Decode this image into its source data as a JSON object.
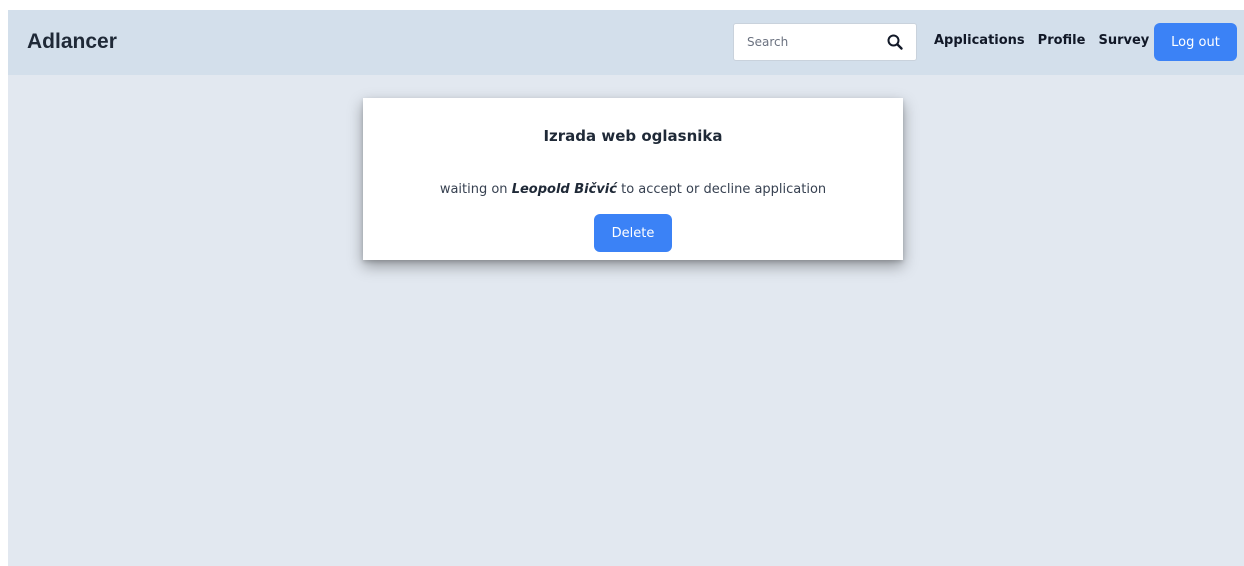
{
  "header": {
    "brand": "Adlancer",
    "search": {
      "placeholder": "Search",
      "value": "",
      "icon": "search-icon"
    },
    "nav": [
      {
        "label": "Applications"
      },
      {
        "label": "Profile"
      },
      {
        "label": "Survey"
      }
    ],
    "logout_label": "Log out"
  },
  "application": {
    "title": "Izrada web oglasnika",
    "status_prefix": "waiting on",
    "person": "Leopold Bičvić",
    "status_suffix": "to accept or decline application",
    "delete_label": "Delete"
  },
  "colors": {
    "page_background": "#e2e8f0",
    "navbar_background": "#d3dfeb",
    "primary_button": "#3b82f6",
    "card_background": "#ffffff"
  }
}
